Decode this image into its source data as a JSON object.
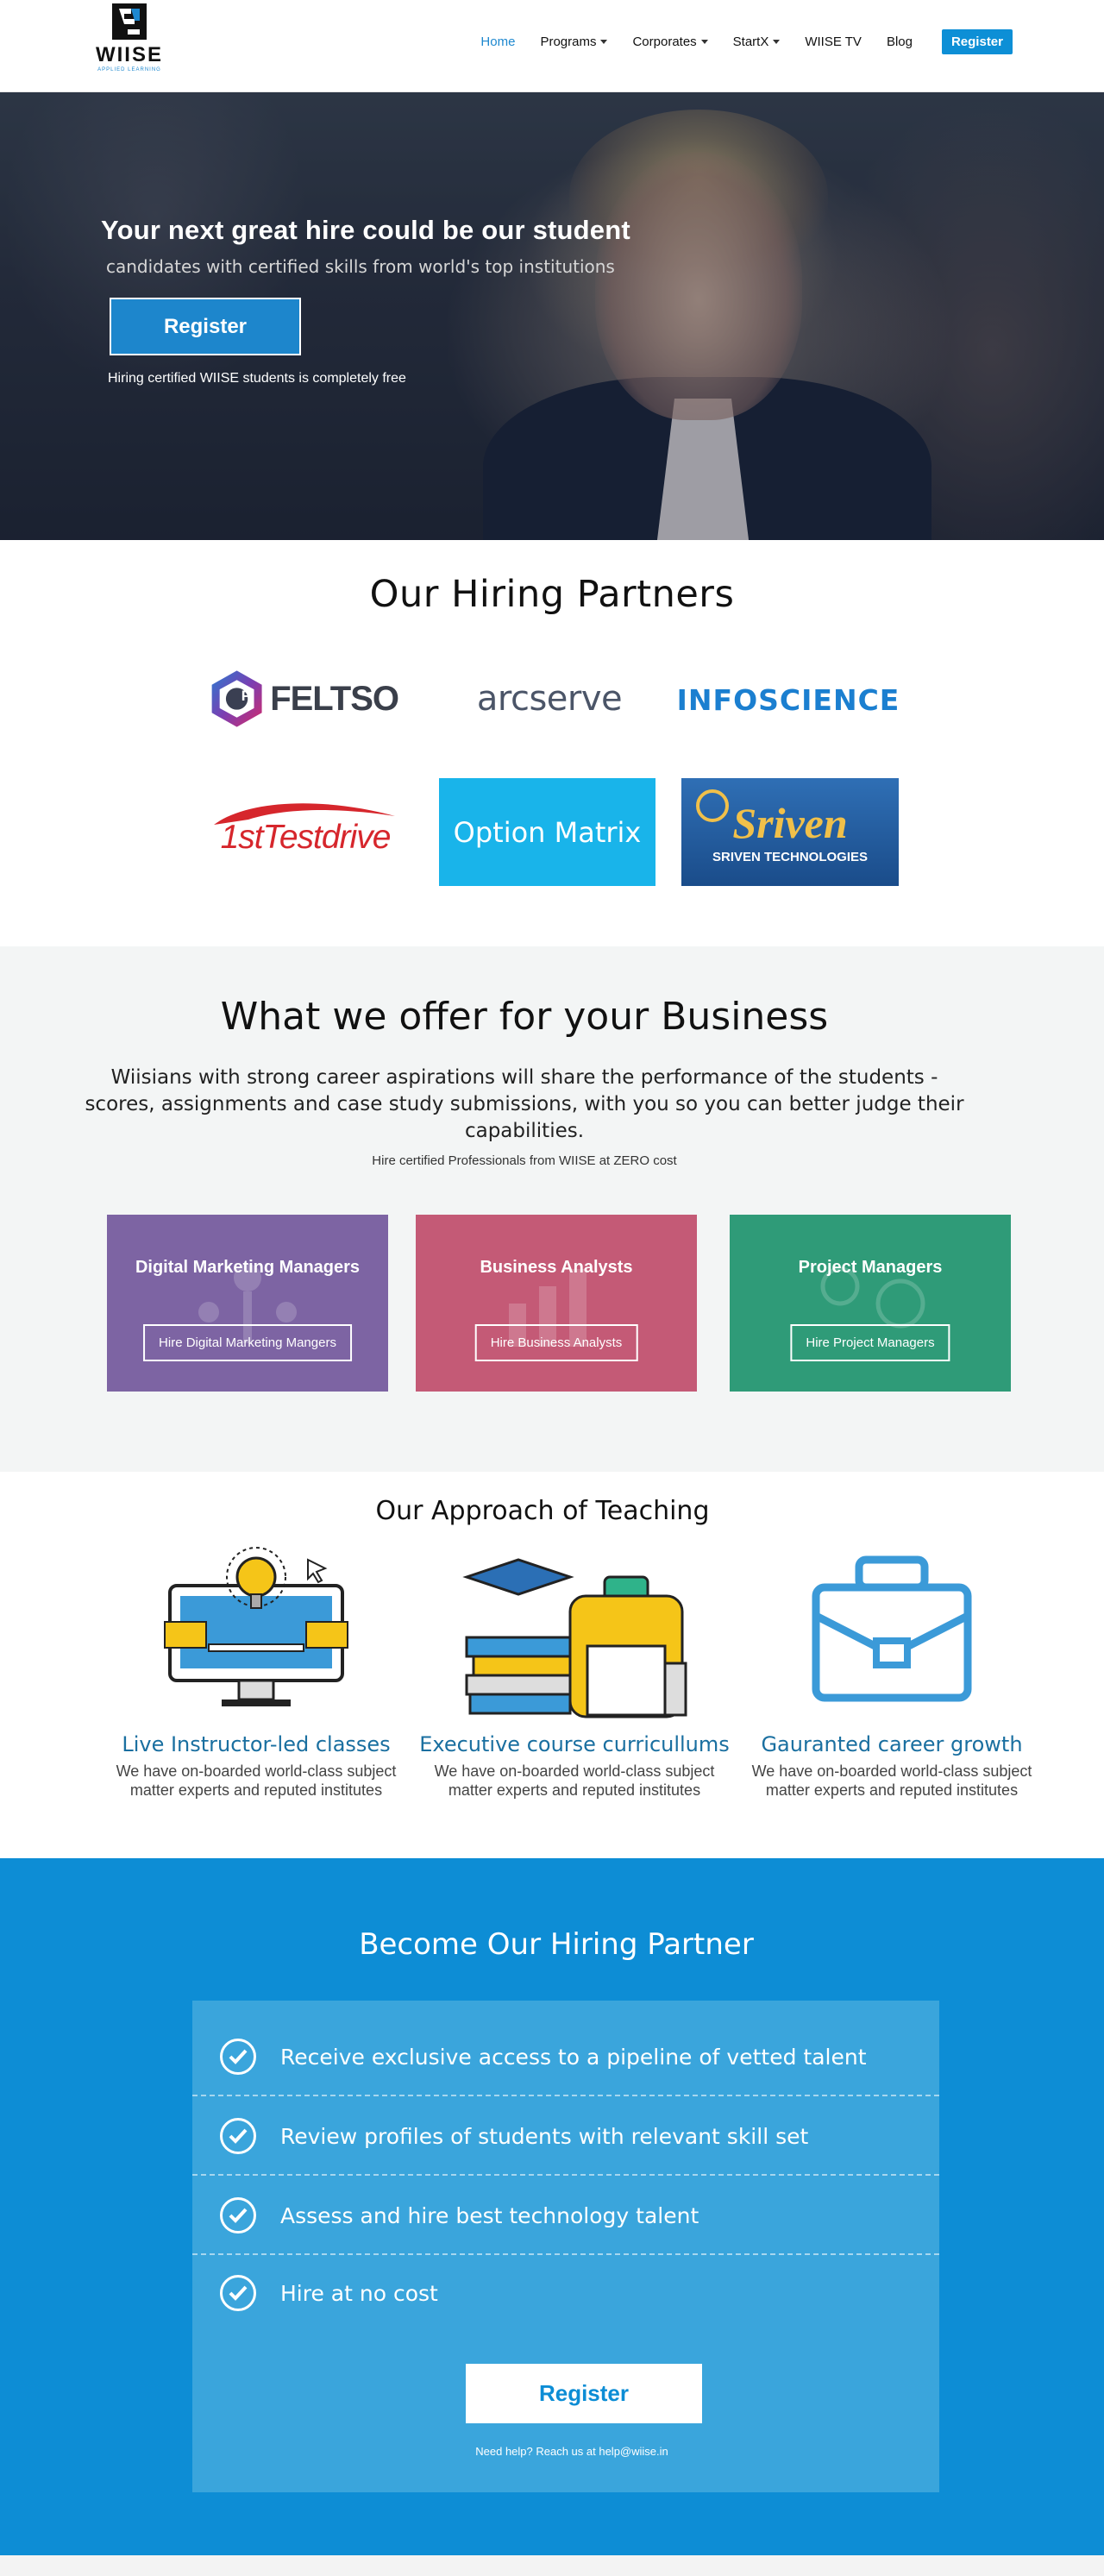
{
  "brand": {
    "name": "WIISE",
    "tagline": "APPLIED LEARNING",
    "accent": "#0d8fd6"
  },
  "nav": {
    "items": [
      {
        "label": "Home",
        "dropdown": false,
        "active": true
      },
      {
        "label": "Programs",
        "dropdown": true,
        "active": false
      },
      {
        "label": "Corporates",
        "dropdown": true,
        "active": false
      },
      {
        "label": "StartX",
        "dropdown": true,
        "active": false
      },
      {
        "label": "WIISE TV",
        "dropdown": false,
        "active": false
      },
      {
        "label": "Blog",
        "dropdown": false,
        "active": false
      }
    ],
    "register_label": "Register"
  },
  "hero": {
    "title": "Your next great hire could be our student",
    "subtitle": "candidates with certified skills from world's top institutions",
    "button_label": "Register",
    "note": "Hiring certified WIISE students is completely free"
  },
  "partners": {
    "title": "Our Hiring Partners",
    "logos": [
      {
        "name": "FELTSO",
        "badge_letter": "F"
      },
      {
        "name": "arcserve"
      },
      {
        "name": "INFOSCIENCE"
      },
      {
        "name": "1stTestdrive"
      },
      {
        "name": "Option Matrix"
      },
      {
        "name": "Sriven",
        "sub": "SRIVEN TECHNOLOGIES"
      }
    ]
  },
  "offer": {
    "title": "What we offer for your Business",
    "description": "Wiisians with strong career aspirations will share the performance of the students - scores, assignments and case study submissions, with you so you can better judge their capabilities.",
    "note": "Hire certified Professionals from WIISE at ZERO cost",
    "cards": [
      {
        "title": "Digital Marketing Managers",
        "button": "Hire Digital Marketing Mangers",
        "color": "#7d64a3"
      },
      {
        "title": "Business Analysts",
        "button": "Hire Business Analysts",
        "color": "#c45a76"
      },
      {
        "title": "Project Managers",
        "button": "Hire Project Managers",
        "color": "#2f9b78"
      }
    ]
  },
  "approach": {
    "title": "Our Approach of Teaching",
    "features": [
      {
        "title": "Live Instructor-led classes",
        "desc": "We have on-boarded world-class subject matter experts and reputed institutes",
        "icon": "monitor-lightbulb-icon"
      },
      {
        "title": "Executive course curricullums",
        "desc": "We have on-boarded world-class subject matter experts and reputed institutes",
        "icon": "books-bag-icon"
      },
      {
        "title": "Gauranted career growth",
        "desc": "We have on-boarded world-class subject matter experts and reputed institutes",
        "icon": "briefcase-icon"
      }
    ]
  },
  "become": {
    "title": "Become Our Hiring Partner",
    "items": [
      "Receive exclusive access to a pipeline of vetted talent",
      "Review profiles of students with relevant skill set",
      "Assess and hire best technology talent",
      "Hire at no cost"
    ],
    "button_label": "Register",
    "help": "Need help? Reach us at help@wiise.in"
  }
}
